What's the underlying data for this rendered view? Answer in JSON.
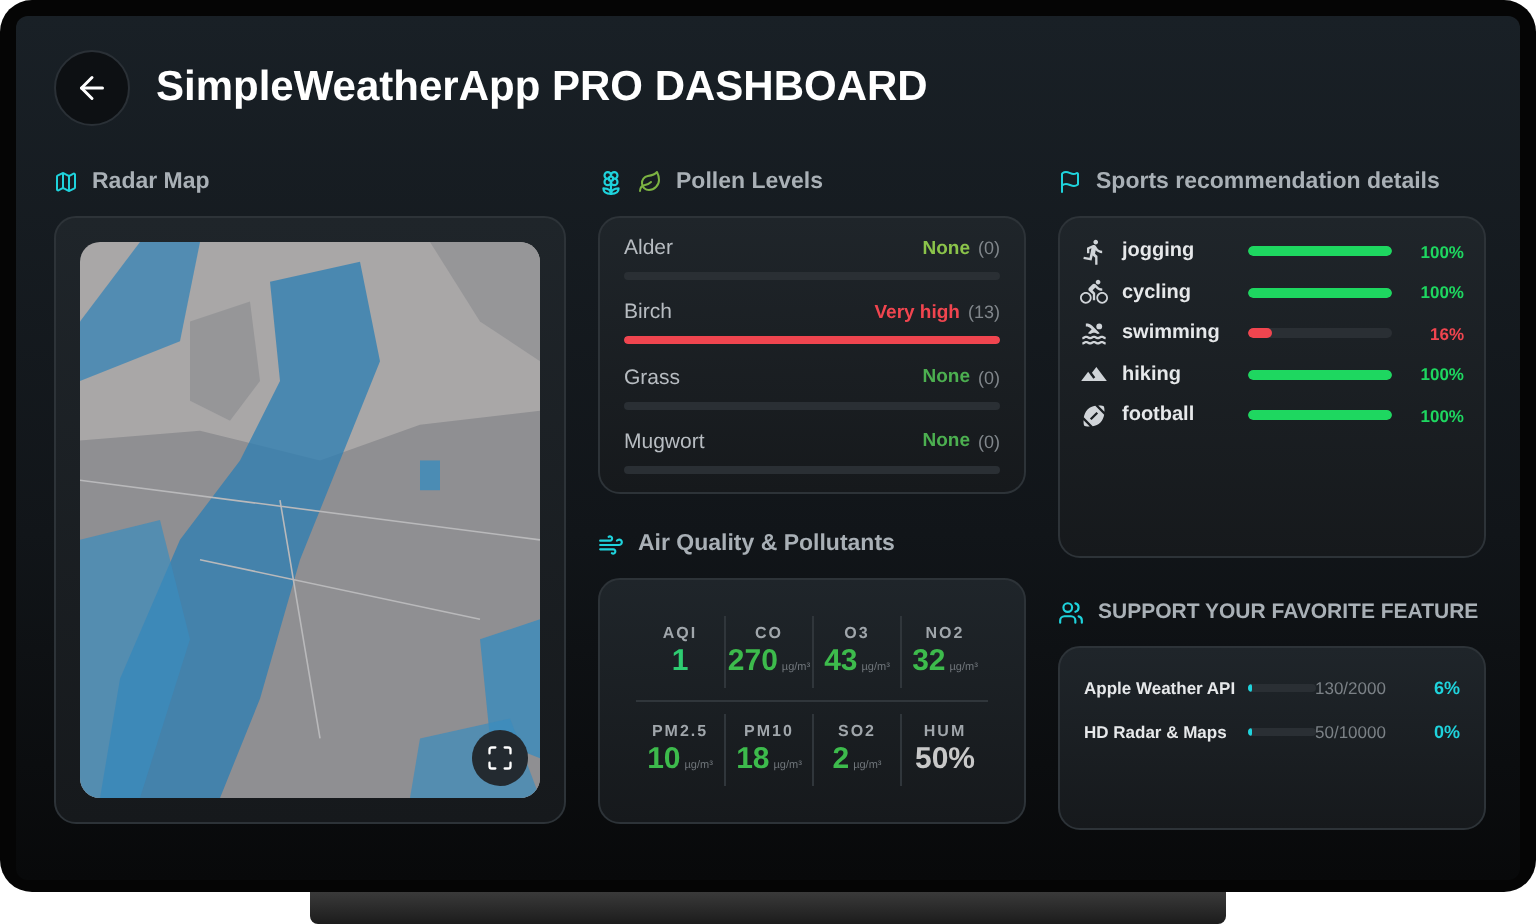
{
  "header": {
    "title": "SimpleWeatherApp PRO DASHBOARD"
  },
  "radar": {
    "title": "Radar Map"
  },
  "pollen": {
    "title": "Pollen Levels",
    "items": [
      {
        "name": "Alder",
        "rating": "None",
        "count": "(0)",
        "level": 0,
        "color": "#8bc34a"
      },
      {
        "name": "Birch",
        "rating": "Very high",
        "count": "(13)",
        "level": 1,
        "color": "#f0454f"
      },
      {
        "name": "Grass",
        "rating": "None",
        "count": "(0)",
        "level": 0,
        "color": "#4caf50"
      },
      {
        "name": "Mugwort",
        "rating": "None",
        "count": "(0)",
        "level": 0,
        "color": "#4caf50"
      }
    ]
  },
  "air_quality": {
    "title": "Air Quality & Pollutants",
    "cells": [
      {
        "label": "AQI",
        "value": "1",
        "color": "#2ecc71"
      },
      {
        "label": "CO",
        "value": "270",
        "unit": "µg/m³",
        "color": "#3dbb4c"
      },
      {
        "label": "O3",
        "value": "43",
        "unit": "µg/m³",
        "color": "#3dbb4c"
      },
      {
        "label": "NO2",
        "value": "32",
        "unit": "µg/m³",
        "color": "#3dbb4c"
      },
      {
        "label": "PM2.5",
        "value": "10",
        "unit": "µg/m³",
        "color": "#3dbb4c"
      },
      {
        "label": "PM10",
        "value": "18",
        "unit": "µg/m³",
        "color": "#3dbb4c"
      },
      {
        "label": "SO2",
        "value": "2",
        "unit": "µg/m³",
        "color": "#3dbb4c"
      },
      {
        "label": "HUM",
        "value": "50%",
        "color": "#c8c8c8"
      }
    ]
  },
  "sports": {
    "title": "Sports recommendation details",
    "items": [
      {
        "kind": "running",
        "name": "jogging",
        "level": 1,
        "percent": "100%",
        "color": "#1ed760"
      },
      {
        "kind": "cycling",
        "name": "cycling",
        "level": 1,
        "percent": "100%",
        "color": "#1ed760"
      },
      {
        "kind": "swimming",
        "name": "swimming",
        "level": 0.16,
        "percent": "16%",
        "color": "#f0454f"
      },
      {
        "kind": "hiking",
        "name": "hiking",
        "level": 1,
        "percent": "100%",
        "color": "#1ed760"
      },
      {
        "kind": "football",
        "name": "football",
        "level": 1,
        "percent": "100%",
        "color": "#1ed760"
      }
    ]
  },
  "support": {
    "title": "SUPPORT YOUR FAVORITE FEATURE",
    "items": [
      {
        "name": "Apple Weather API",
        "level": 0.065,
        "count": "130/2000",
        "percent": "6%"
      },
      {
        "name": "HD Radar & Maps",
        "level": 0.005,
        "count": "50/10000",
        "percent": "0%"
      }
    ]
  }
}
